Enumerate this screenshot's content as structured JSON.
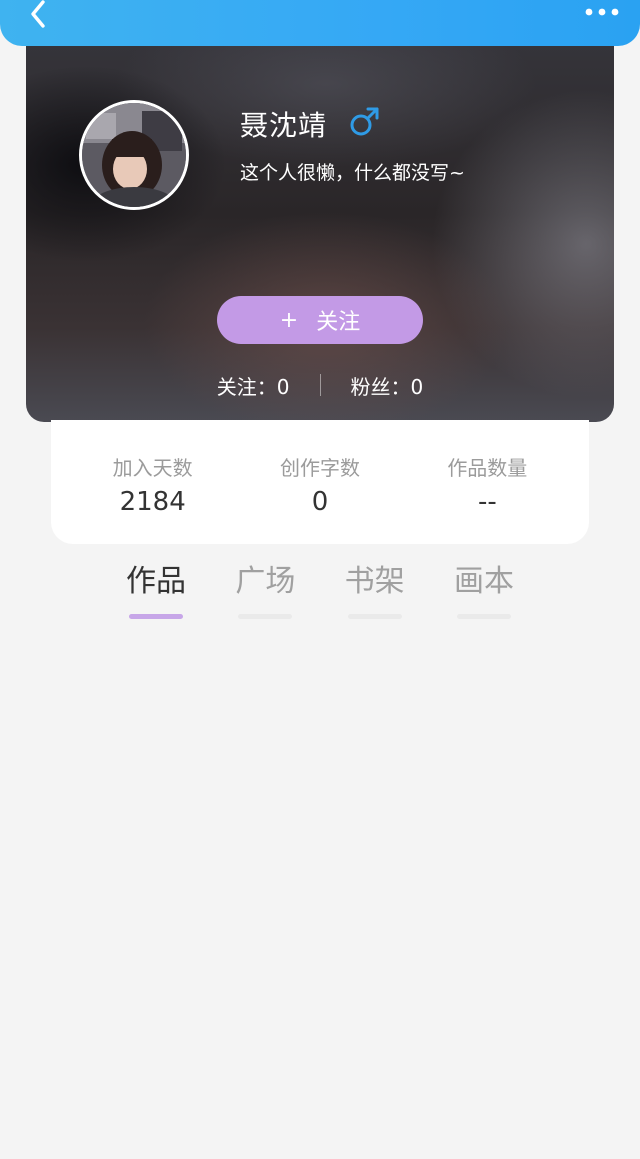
{
  "topbar": {
    "back_icon": "chevron-left-icon",
    "more_icon": "more-dots-icon",
    "color": "#35a8f5"
  },
  "profile": {
    "name": "聂沈靖",
    "gender_icon": "male-icon",
    "gender_color": "#2f9be6",
    "bio": "这个人很懒，什么都没写~",
    "follow_button": {
      "plus": "+",
      "label": "关注",
      "color": "#c39ae6"
    },
    "following": "关注：0",
    "fans": "粉丝：0"
  },
  "stats": [
    {
      "label": "加入天数",
      "value": "2184"
    },
    {
      "label": "创作字数",
      "value": "0"
    },
    {
      "label": "作品数量",
      "value": "--"
    }
  ],
  "tabs": [
    {
      "label": "作品",
      "active": true
    },
    {
      "label": "广场",
      "active": false
    },
    {
      "label": "书架",
      "active": false
    },
    {
      "label": "画本",
      "active": false
    }
  ],
  "accent_color": "#c7a6e8"
}
